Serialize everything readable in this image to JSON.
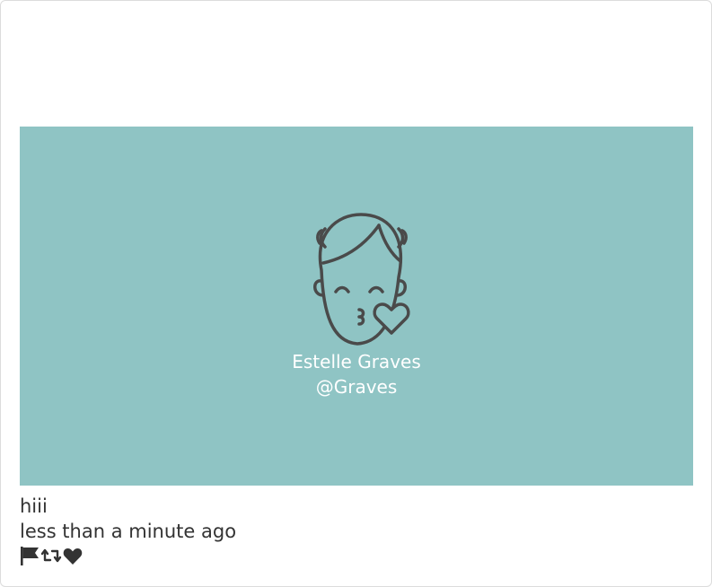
{
  "profile": {
    "name": "Estelle Graves",
    "handle": "@Graves",
    "banner_color": "#8fc4c4",
    "avatar_icon": "kissing-face-heart-icon"
  },
  "post": {
    "text": "hiii",
    "timestamp": "less than a minute ago"
  },
  "actions": [
    {
      "icon": "flag-icon"
    },
    {
      "icon": "retweet-icon"
    },
    {
      "icon": "heart-icon"
    }
  ]
}
